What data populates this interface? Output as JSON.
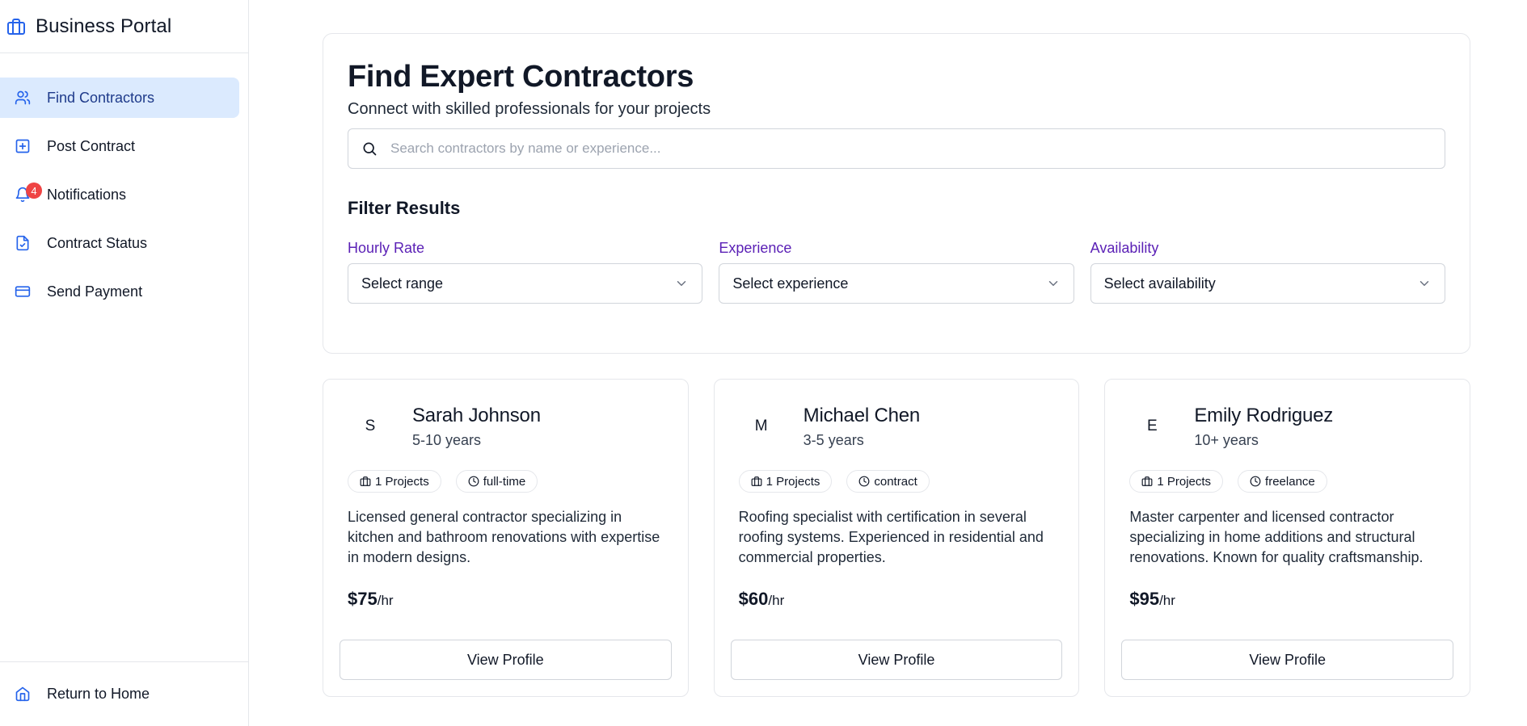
{
  "app": {
    "title": "Business Portal"
  },
  "sidebar": {
    "items": [
      {
        "label": "Find Contractors",
        "icon": "users-icon",
        "active": true
      },
      {
        "label": "Post Contract",
        "icon": "plus-square-icon"
      },
      {
        "label": "Notifications",
        "icon": "bell-icon",
        "badge": "4"
      },
      {
        "label": "Contract Status",
        "icon": "file-check-icon"
      },
      {
        "label": "Send Payment",
        "icon": "credit-card-icon"
      }
    ],
    "footer": {
      "label": "Return to Home",
      "icon": "home-icon"
    }
  },
  "search_panel": {
    "title": "Find Expert Contractors",
    "subtitle": "Connect with skilled professionals for your projects",
    "search_placeholder": "Search contractors by name or experience...",
    "filter_heading": "Filter Results",
    "filters": [
      {
        "label": "Hourly Rate",
        "value": "Select range"
      },
      {
        "label": "Experience",
        "value": "Select experience"
      },
      {
        "label": "Availability",
        "value": "Select availability"
      }
    ]
  },
  "contractors": [
    {
      "initial": "S",
      "name": "Sarah Johnson",
      "years": "5-10 years",
      "projects": "1 Projects",
      "type": "full-time",
      "description": "Licensed general contractor specializing in kitchen and bathroom renovations with expertise in modern designs.",
      "rate": "$75",
      "rate_unit": "/hr",
      "button": "View Profile"
    },
    {
      "initial": "M",
      "name": "Michael Chen",
      "years": "3-5 years",
      "projects": "1 Projects",
      "type": "contract",
      "description": "Roofing specialist with certification in several roofing systems. Experienced in residential and commercial properties.",
      "rate": "$60",
      "rate_unit": "/hr",
      "button": "View Profile"
    },
    {
      "initial": "E",
      "name": "Emily Rodriguez",
      "years": "10+ years",
      "projects": "1 Projects",
      "type": "freelance",
      "description": "Master carpenter and licensed contractor specializing in home additions and structural renovations. Known for quality craftsmanship.",
      "rate": "$95",
      "rate_unit": "/hr",
      "button": "View Profile"
    }
  ],
  "colors": {
    "accent": "#2563eb",
    "active_bg": "#dbeafe",
    "filter_label": "#5b21b6",
    "badge": "#ef4444"
  }
}
